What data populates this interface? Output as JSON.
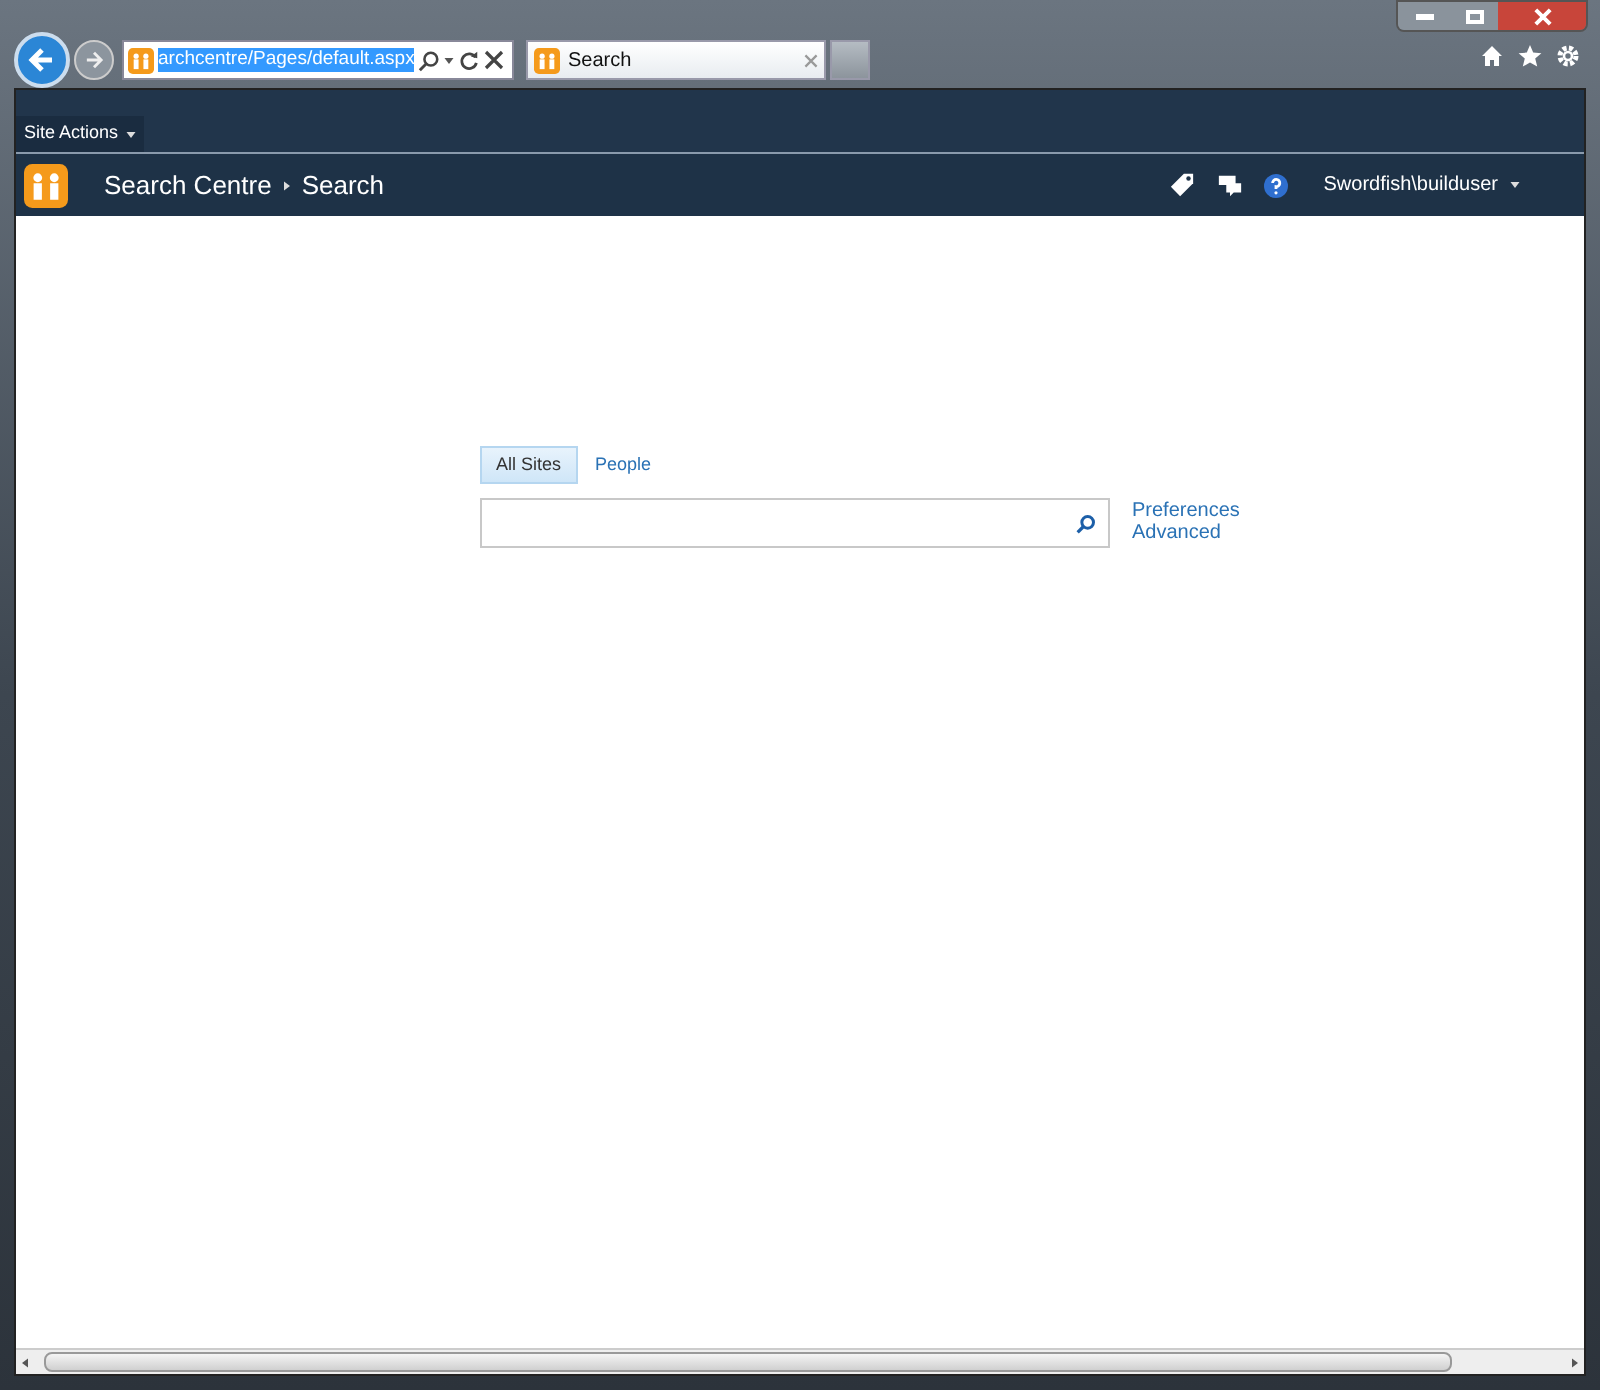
{
  "browser": {
    "address": "archcentre/Pages/default.aspx",
    "tabs": [
      {
        "title": "Search",
        "selected": true
      }
    ]
  },
  "ribbon": {
    "site_actions": "Site Actions"
  },
  "title_bar": {
    "breadcrumb": [
      "Search Centre",
      "Search"
    ],
    "user": "Swordfish\\builduser"
  },
  "search": {
    "scopes": [
      {
        "label": "All Sites",
        "selected": true
      },
      {
        "label": "People",
        "selected": false
      }
    ],
    "links": [
      "Preferences",
      "Advanced"
    ]
  }
}
